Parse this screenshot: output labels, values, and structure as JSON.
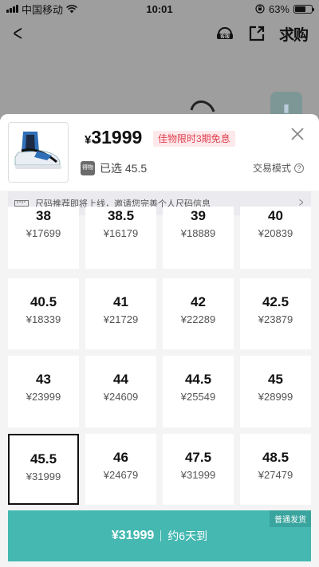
{
  "status_bar": {
    "carrier": "中国移动",
    "time": "10:01",
    "battery": "63%",
    "battery_level": 0.63
  },
  "nav": {
    "service_label": "客服",
    "seek_label": "求购"
  },
  "product": {
    "price_currency": "¥",
    "price": "31999",
    "promo": "佳物限时3期免息",
    "selected_label": "已选 45.5",
    "selected_tag": "得物",
    "trade_mode": "交易模式"
  },
  "size_hint": "尺码推荐即将上线，邀请您完善个人尺码信息",
  "sizes": [
    {
      "size": "38",
      "price": "¥17699"
    },
    {
      "size": "38.5",
      "price": "¥16179"
    },
    {
      "size": "39",
      "price": "¥18889"
    },
    {
      "size": "40",
      "price": "¥20839"
    },
    {
      "size": "40.5",
      "price": "¥18339"
    },
    {
      "size": "41",
      "price": "¥21729"
    },
    {
      "size": "42",
      "price": "¥22289"
    },
    {
      "size": "42.5",
      "price": "¥23879"
    },
    {
      "size": "43",
      "price": "¥23999"
    },
    {
      "size": "44",
      "price": "¥24609"
    },
    {
      "size": "44.5",
      "price": "¥25549"
    },
    {
      "size": "45",
      "price": "¥28999"
    },
    {
      "size": "45.5",
      "price": "¥31999"
    },
    {
      "size": "46",
      "price": "¥24679"
    },
    {
      "size": "47.5",
      "price": "¥31999"
    },
    {
      "size": "48.5",
      "price": "¥27479"
    }
  ],
  "selected_size": "45.5",
  "buy_bar": {
    "price": "¥31999",
    "delivery": "约6天到",
    "ship_tag": "普通发货"
  }
}
